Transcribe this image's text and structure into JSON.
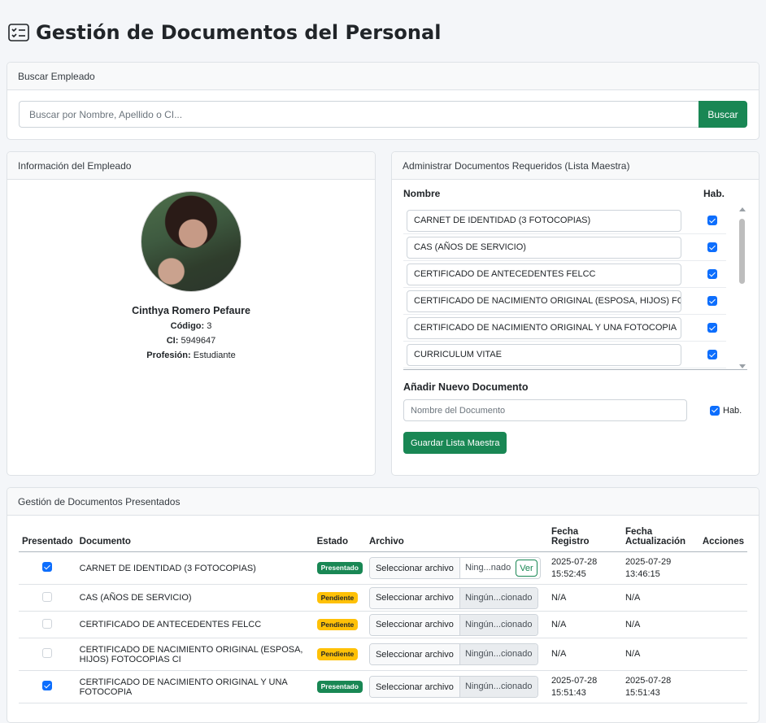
{
  "page": {
    "title": "Gestión de Documentos del Personal"
  },
  "search": {
    "header": "Buscar Empleado",
    "placeholder": "Buscar por Nombre, Apellido o CI...",
    "button": "Buscar"
  },
  "employee": {
    "header": "Información del Empleado",
    "name": "Cinthya Romero Pefaure",
    "code_label": "Código:",
    "code": "3",
    "ci_label": "CI:",
    "ci": "5949647",
    "profession_label": "Profesión:",
    "profession": "Estudiante"
  },
  "master": {
    "header": "Administrar Documentos Requeridos (Lista Maestra)",
    "col_name": "Nombre",
    "col_hab": "Hab.",
    "items": [
      {
        "name": "CARNET DE IDENTIDAD (3 FOTOCOPIAS)",
        "enabled": true
      },
      {
        "name": "CAS (AÑOS DE SERVICIO)",
        "enabled": true
      },
      {
        "name": "CERTIFICADO DE ANTECEDENTES FELCC",
        "enabled": true
      },
      {
        "name": "CERTIFICADO DE NACIMIENTO ORIGINAL (ESPOSA, HIJOS) FOTOCOPIAS CI",
        "enabled": true
      },
      {
        "name": "CERTIFICADO DE NACIMIENTO ORIGINAL Y UNA FOTOCOPIA",
        "enabled": true
      },
      {
        "name": "CURRICULUM VITAE",
        "enabled": true
      }
    ],
    "add_title": "Añadir Nuevo Documento",
    "add_placeholder": "Nombre del Documento",
    "add_hab": "Hab.",
    "save_button": "Guardar Lista Maestra"
  },
  "presented": {
    "header": "Gestión de Documentos Presentados",
    "columns": {
      "presented": "Presentado",
      "document": "Documento",
      "status": "Estado",
      "file": "Archivo",
      "reg_date": "Fecha Registro",
      "upd_date_1": "Fecha",
      "upd_date_2": "Actualización",
      "actions": "Acciones"
    },
    "file_button": "Seleccionar archivo",
    "view_button": "Ver",
    "rows": [
      {
        "presented": true,
        "document": "CARNET DE IDENTIDAD (3 FOTOCOPIAS)",
        "status": "Presentado",
        "file": "Ning...nado",
        "has_view": true,
        "reg_date": "2025-07-28",
        "reg_time": "15:52:45",
        "upd_date": "2025-07-29",
        "upd_time": "13:46:15"
      },
      {
        "presented": false,
        "document": "CAS (AÑOS DE SERVICIO)",
        "status": "Pendiente",
        "file": "Ningún...cionado",
        "has_view": false,
        "reg_date": "N/A",
        "reg_time": "",
        "upd_date": "N/A",
        "upd_time": ""
      },
      {
        "presented": false,
        "document": "CERTIFICADO DE ANTECEDENTES FELCC",
        "status": "Pendiente",
        "file": "Ningún...cionado",
        "has_view": false,
        "reg_date": "N/A",
        "reg_time": "",
        "upd_date": "N/A",
        "upd_time": ""
      },
      {
        "presented": false,
        "document": "CERTIFICADO DE NACIMIENTO ORIGINAL (ESPOSA, HIJOS) FOTOCOPIAS CI",
        "status": "Pendiente",
        "file": "Ningún...cionado",
        "has_view": false,
        "reg_date": "N/A",
        "reg_time": "",
        "upd_date": "N/A",
        "upd_time": ""
      },
      {
        "presented": true,
        "document": "CERTIFICADO DE NACIMIENTO ORIGINAL Y UNA FOTOCOPIA",
        "status": "Presentado",
        "file": "Ningún...cionado",
        "has_view": false,
        "reg_date": "2025-07-28",
        "reg_time": "15:51:43",
        "upd_date": "2025-07-28",
        "upd_time": "15:51:43"
      }
    ]
  }
}
